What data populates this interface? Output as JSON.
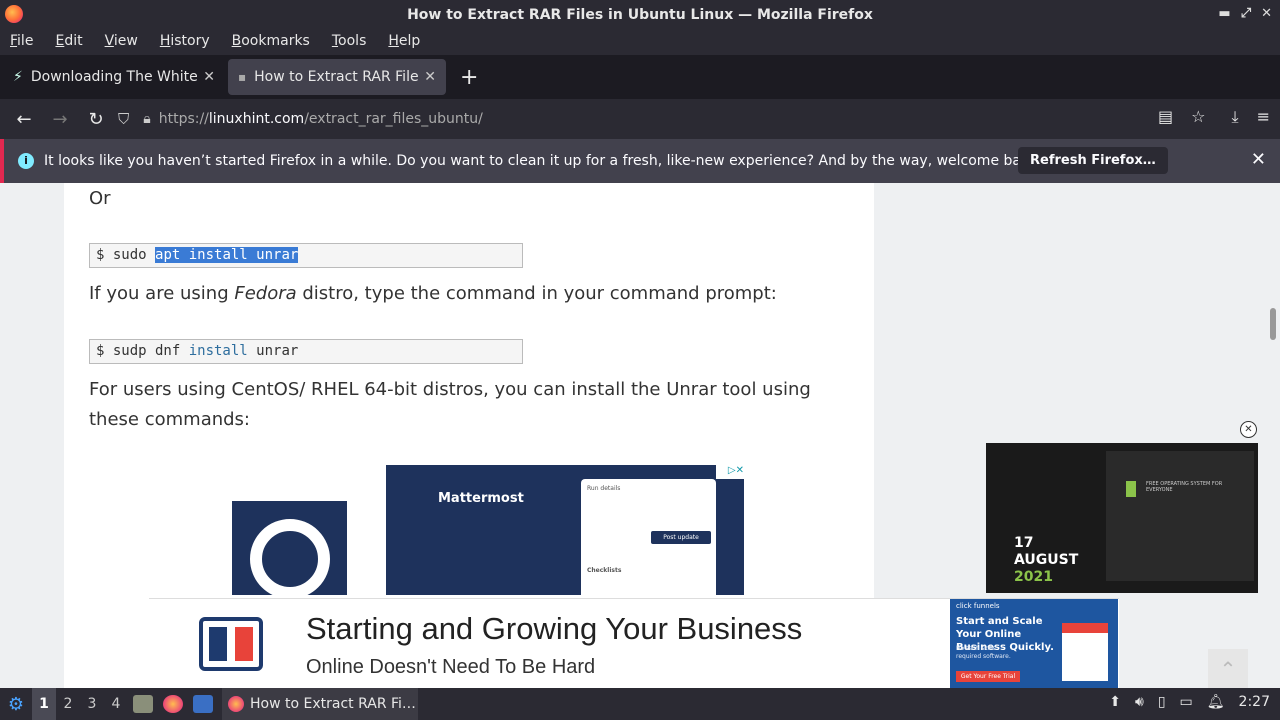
{
  "window": {
    "title": "How to Extract RAR Files in Ubuntu Linux — Mozilla Firefox"
  },
  "menu": [
    "File",
    "Edit",
    "View",
    "History",
    "Bookmarks",
    "Tools",
    "Help"
  ],
  "tabs": [
    {
      "title": "Downloading The White House",
      "active": false
    },
    {
      "title": "How to Extract RAR Files in Ubuntu Linux",
      "active": true
    }
  ],
  "url": {
    "prefix": "https://",
    "domain": "linuxhint.com",
    "path": "/extract_rar_files_ubuntu/"
  },
  "notification": {
    "message": "It looks like you haven’t started Firefox in a while. Do you want to clean it up for a fresh, like-new experience? And by the way, welcome back!",
    "button": "Refresh Firefox…"
  },
  "article": {
    "or": "Or",
    "cmd1": {
      "prompt": "$ sudo ",
      "selected": "apt install unrar"
    },
    "fedora_pre": "If you are using ",
    "fedora_em": "Fedora",
    "fedora_post": " distro, type the command in your command prompt:",
    "cmd2": {
      "prompt": "$ sudp dnf ",
      "kw": "install",
      "rest": " unrar"
    },
    "centos": "For users using CentOS/ RHEL 64-bit distros, you can install the Unrar tool using these commands:"
  },
  "ad_mattermost": {
    "brand": "Mattermost",
    "card_title": "Run details",
    "card_btn": "Post update",
    "card_section": "Checklists"
  },
  "video_ad": {
    "day": "17",
    "month": "AUGUST",
    "year": "2021",
    "headline": "FREE OPERATING SYSTEM FOR EVERYONE"
  },
  "bottom_ad": {
    "title": "Starting and Growing Your Business",
    "subtitle": "Online Doesn't Need To Be Hard",
    "side_brand": "click funnels",
    "side_head": "Start and Scale Your Online Business Quickly.",
    "side_small": "No tech skills required software.",
    "side_cta": "Get Your Free Trial"
  },
  "taskbar": {
    "workspaces": [
      "1",
      "2",
      "3",
      "4"
    ],
    "app_title": "How to Extract RAR Fi…",
    "clock": "2:27"
  }
}
